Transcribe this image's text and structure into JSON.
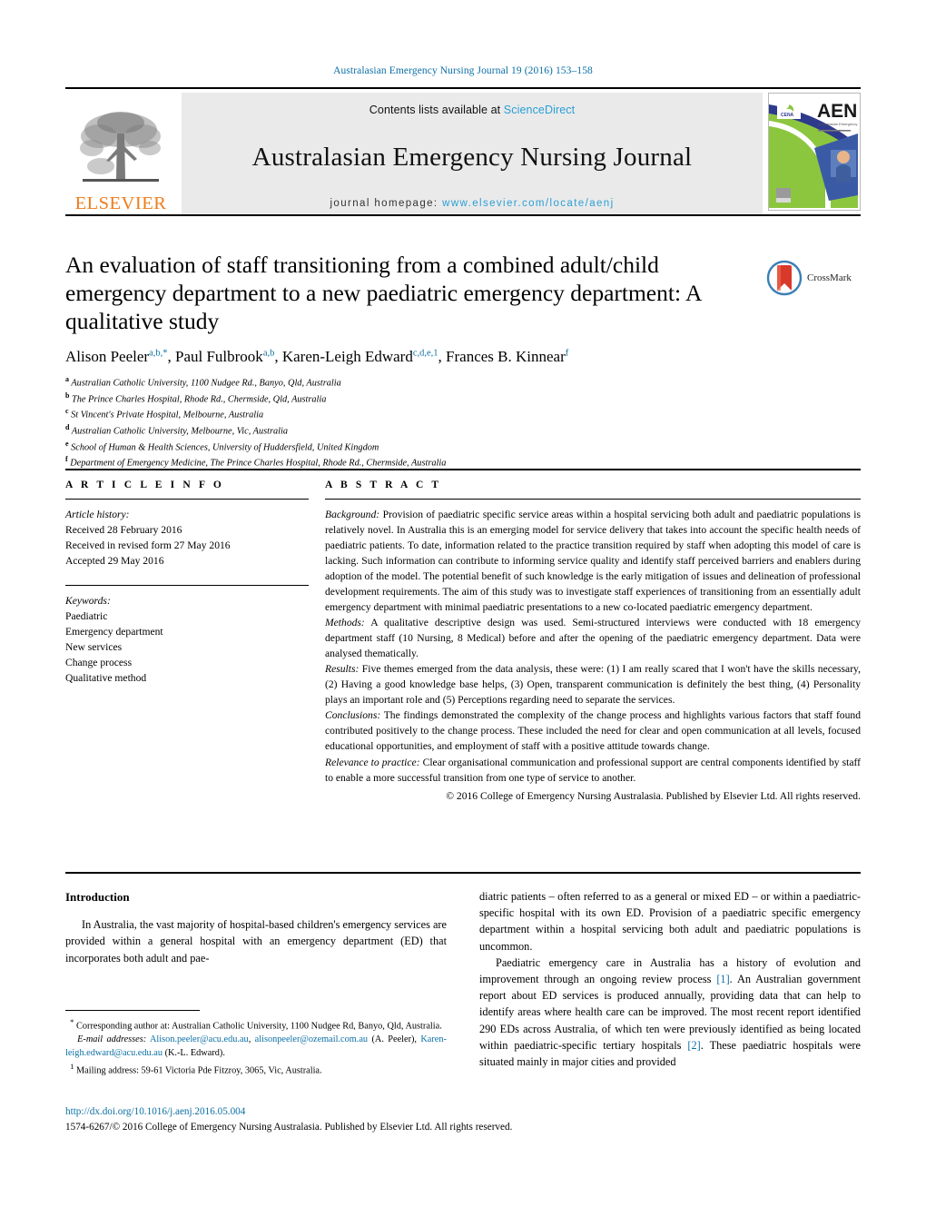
{
  "running_head": "Australasian Emergency Nursing Journal 19 (2016) 153–158",
  "masthead": {
    "publisher_name": "ELSEVIER",
    "contents_prefix": "Contents lists available at ",
    "contents_link": "ScienceDirect",
    "journal_title": "Australasian Emergency Nursing Journal",
    "homepage_prefix": "journal homepage: ",
    "homepage_url": "www.elsevier.com/locate/aenj",
    "cover_abbrev": "AENJ",
    "cover_society": "CENA",
    "cover_subtitle": "Australasian Emergency Nursing Journal"
  },
  "article": {
    "title": "An evaluation of staff transitioning from a combined adult/child emergency department to a new paediatric emergency department: A qualitative study",
    "crossmark_label": "CrossMark",
    "authors": [
      {
        "name": "Alison Peeler",
        "sup": "a,b,*"
      },
      {
        "name": "Paul Fulbrook",
        "sup": "a,b"
      },
      {
        "name": "Karen-Leigh Edward",
        "sup": "c,d,e,1"
      },
      {
        "name": "Frances B. Kinnear",
        "sup": "f"
      }
    ],
    "affiliations": [
      {
        "mark": "a",
        "text": "Australian Catholic University, 1100 Nudgee Rd., Banyo, Qld, Australia"
      },
      {
        "mark": "b",
        "text": "The Prince Charles Hospital, Rhode Rd., Chermside, Qld, Australia"
      },
      {
        "mark": "c",
        "text": "St Vincent's Private Hospital, Melbourne, Australia"
      },
      {
        "mark": "d",
        "text": "Australian Catholic University, Melbourne, Vic, Australia"
      },
      {
        "mark": "e",
        "text": "School of Human & Health Sciences, University of Huddersfield, United Kingdom"
      },
      {
        "mark": "f",
        "text": "Department of Emergency Medicine, The Prince Charles Hospital, Rhode Rd., Chermside, Australia"
      }
    ]
  },
  "article_info": {
    "heading": "A R T I C L E   I N F O",
    "history_label": "Article history:",
    "history": [
      "Received 28 February 2016",
      "Received in revised form 27 May 2016",
      "Accepted 29 May 2016"
    ],
    "keywords_label": "Keywords:",
    "keywords": [
      "Paediatric",
      "Emergency department",
      "New services",
      "Change process",
      "Qualitative method"
    ]
  },
  "abstract": {
    "heading": "A B S T R A C T",
    "sections": [
      {
        "label": "Background:",
        "text": " Provision of paediatric specific service areas within a hospital servicing both adult and paediatric populations is relatively novel. In Australia this is an emerging model for service delivery that takes into account the specific health needs of paediatric patients. To date, information related to the practice transition required by staff when adopting this model of care is lacking. Such information can contribute to informing service quality and identify staff perceived barriers and enablers during adoption of the model. The potential benefit of such knowledge is the early mitigation of issues and delineation of professional development requirements. The aim of this study was to investigate staff experiences of transitioning from an essentially adult emergency department with minimal paediatric presentations to a new co-located paediatric emergency department."
      },
      {
        "label": "Methods:",
        "text": " A qualitative descriptive design was used. Semi-structured interviews were conducted with 18 emergency department staff (10 Nursing, 8 Medical) before and after the opening of the paediatric emergency department. Data were analysed thematically."
      },
      {
        "label": "Results:",
        "text": " Five themes emerged from the data analysis, these were: (1) I am really scared that I won't have the skills necessary, (2) Having a good knowledge base helps, (3) Open, transparent communication is definitely the best thing, (4) Personality plays an important role and (5) Perceptions regarding need to separate the services."
      },
      {
        "label": "Conclusions:",
        "text": " The findings demonstrated the complexity of the change process and highlights various factors that staff found contributed positively to the change process. These included the need for clear and open communication at all levels, focused educational opportunities, and employment of staff with a positive attitude towards change."
      },
      {
        "label": "Relevance to practice:",
        "text": " Clear organisational communication and professional support are central components identified by staff to enable a more successful transition from one type of service to another."
      }
    ],
    "copyright": "© 2016 College of Emergency Nursing Australasia. Published by Elsevier Ltd. All rights reserved."
  },
  "body": {
    "heading": "Introduction",
    "left_paragraph": "In Australia, the vast majority of hospital-based children's emergency services are provided within a general hospital with an emergency department (ED) that incorporates both adult and pae-",
    "right_paragraph_1_cont": "diatric patients – often referred to as a general or mixed ED – or within a paediatric-specific hospital with its own ED. Provision of a paediatric specific emergency department within a hospital servicing both adult and paediatric populations is uncommon.",
    "right_paragraph_2_a": "Paediatric emergency care in Australia has a history of evolution and improvement through an ongoing review process ",
    "right_ref_1": "[1]",
    "right_paragraph_2_b": ". An Australian government report about ED services is produced annually, providing data that can help to identify areas where health care can be improved. The most recent report identified 290 EDs across Australia, of which ten were previously identified as being located within paediatric-specific tertiary hospitals ",
    "right_ref_2": "[2]",
    "right_paragraph_2_c": ". These paediatric hospitals were situated mainly in major cities and provided"
  },
  "footnotes": {
    "corresponding": "Corresponding author at: Australian Catholic University, 1100 Nudgee Rd, Banyo, Qld, Australia.",
    "corresponding_mark": "*",
    "email_label": "E-mail addresses:",
    "email_1": "Alison.peeler@acu.edu.au",
    "email_2": "alisonpeeler@ozemail.com.au",
    "email_1_owner": "(A. Peeler),",
    "email_3": "Karen-leigh.edward@acu.edu.au",
    "email_3_owner": "(K.-L. Edward).",
    "mailing_mark": "1",
    "mailing": "Mailing address: 59-61 Victoria Pde Fitzroy, 3065, Vic, Australia."
  },
  "footer": {
    "doi": "http://dx.doi.org/10.1016/j.aenj.2016.05.004",
    "issn_line": "1574-6267/© 2016 College of Emergency Nursing Australasia. Published by Elsevier Ltd. All rights reserved."
  },
  "colors": {
    "link_blue": "#0b6fa4",
    "sciencedirect_blue": "#2a9fd6",
    "elsevier_orange": "#ef7c1a",
    "band_gray": "#eaeaea"
  }
}
